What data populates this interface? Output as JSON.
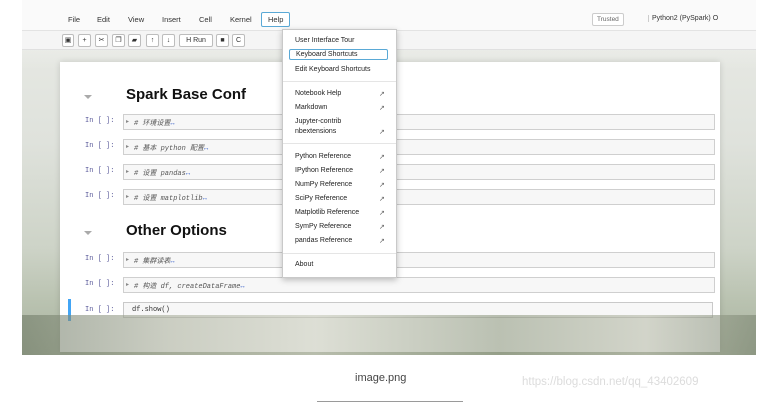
{
  "menubar": {
    "items": [
      "File",
      "Edit",
      "View",
      "Insert",
      "Cell",
      "Kernel"
    ],
    "help": "Help",
    "trusted": "Trusted",
    "kernel_name": "Python2 (PySpark)",
    "kernel_status": "O"
  },
  "toolbar": {
    "run_label": "H Run",
    "c_label": "C"
  },
  "notebook": {
    "heading1": "Spark Base Conf",
    "heading2": "Other Options",
    "prompt": "In [ ]:",
    "cells": [
      {
        "code": "# 环境设置"
      },
      {
        "code": "# 基本 python 配置"
      },
      {
        "code": "# 设置 pandas"
      },
      {
        "code": "# 设置 matplotlib"
      },
      {
        "code": "# 集群读表"
      },
      {
        "code": "# 构造 df, createDataFrame"
      }
    ],
    "ellipsis": "↔",
    "active_code": "df.show()"
  },
  "help_menu": {
    "items": [
      {
        "label": "User Interface Tour"
      },
      {
        "label": "Keyboard Shortcuts"
      },
      {
        "label": "Edit Keyboard Shortcuts"
      },
      {
        "label": "Notebook Help"
      },
      {
        "label": "Markdown"
      },
      {
        "label": "Jupyter-contrib"
      },
      {
        "label": "nbextensions"
      },
      {
        "label": "Python Reference"
      },
      {
        "label": "IPython Reference"
      },
      {
        "label": "NumPy Reference"
      },
      {
        "label": "SciPy Reference"
      },
      {
        "label": "Matplotlib Reference"
      },
      {
        "label": "SymPy Reference"
      },
      {
        "label": "pandas Reference"
      },
      {
        "label": "About"
      }
    ],
    "ext_icon": "↗"
  },
  "caption": "image.png",
  "watermark": "https://blog.csdn.net/qq_43402609"
}
